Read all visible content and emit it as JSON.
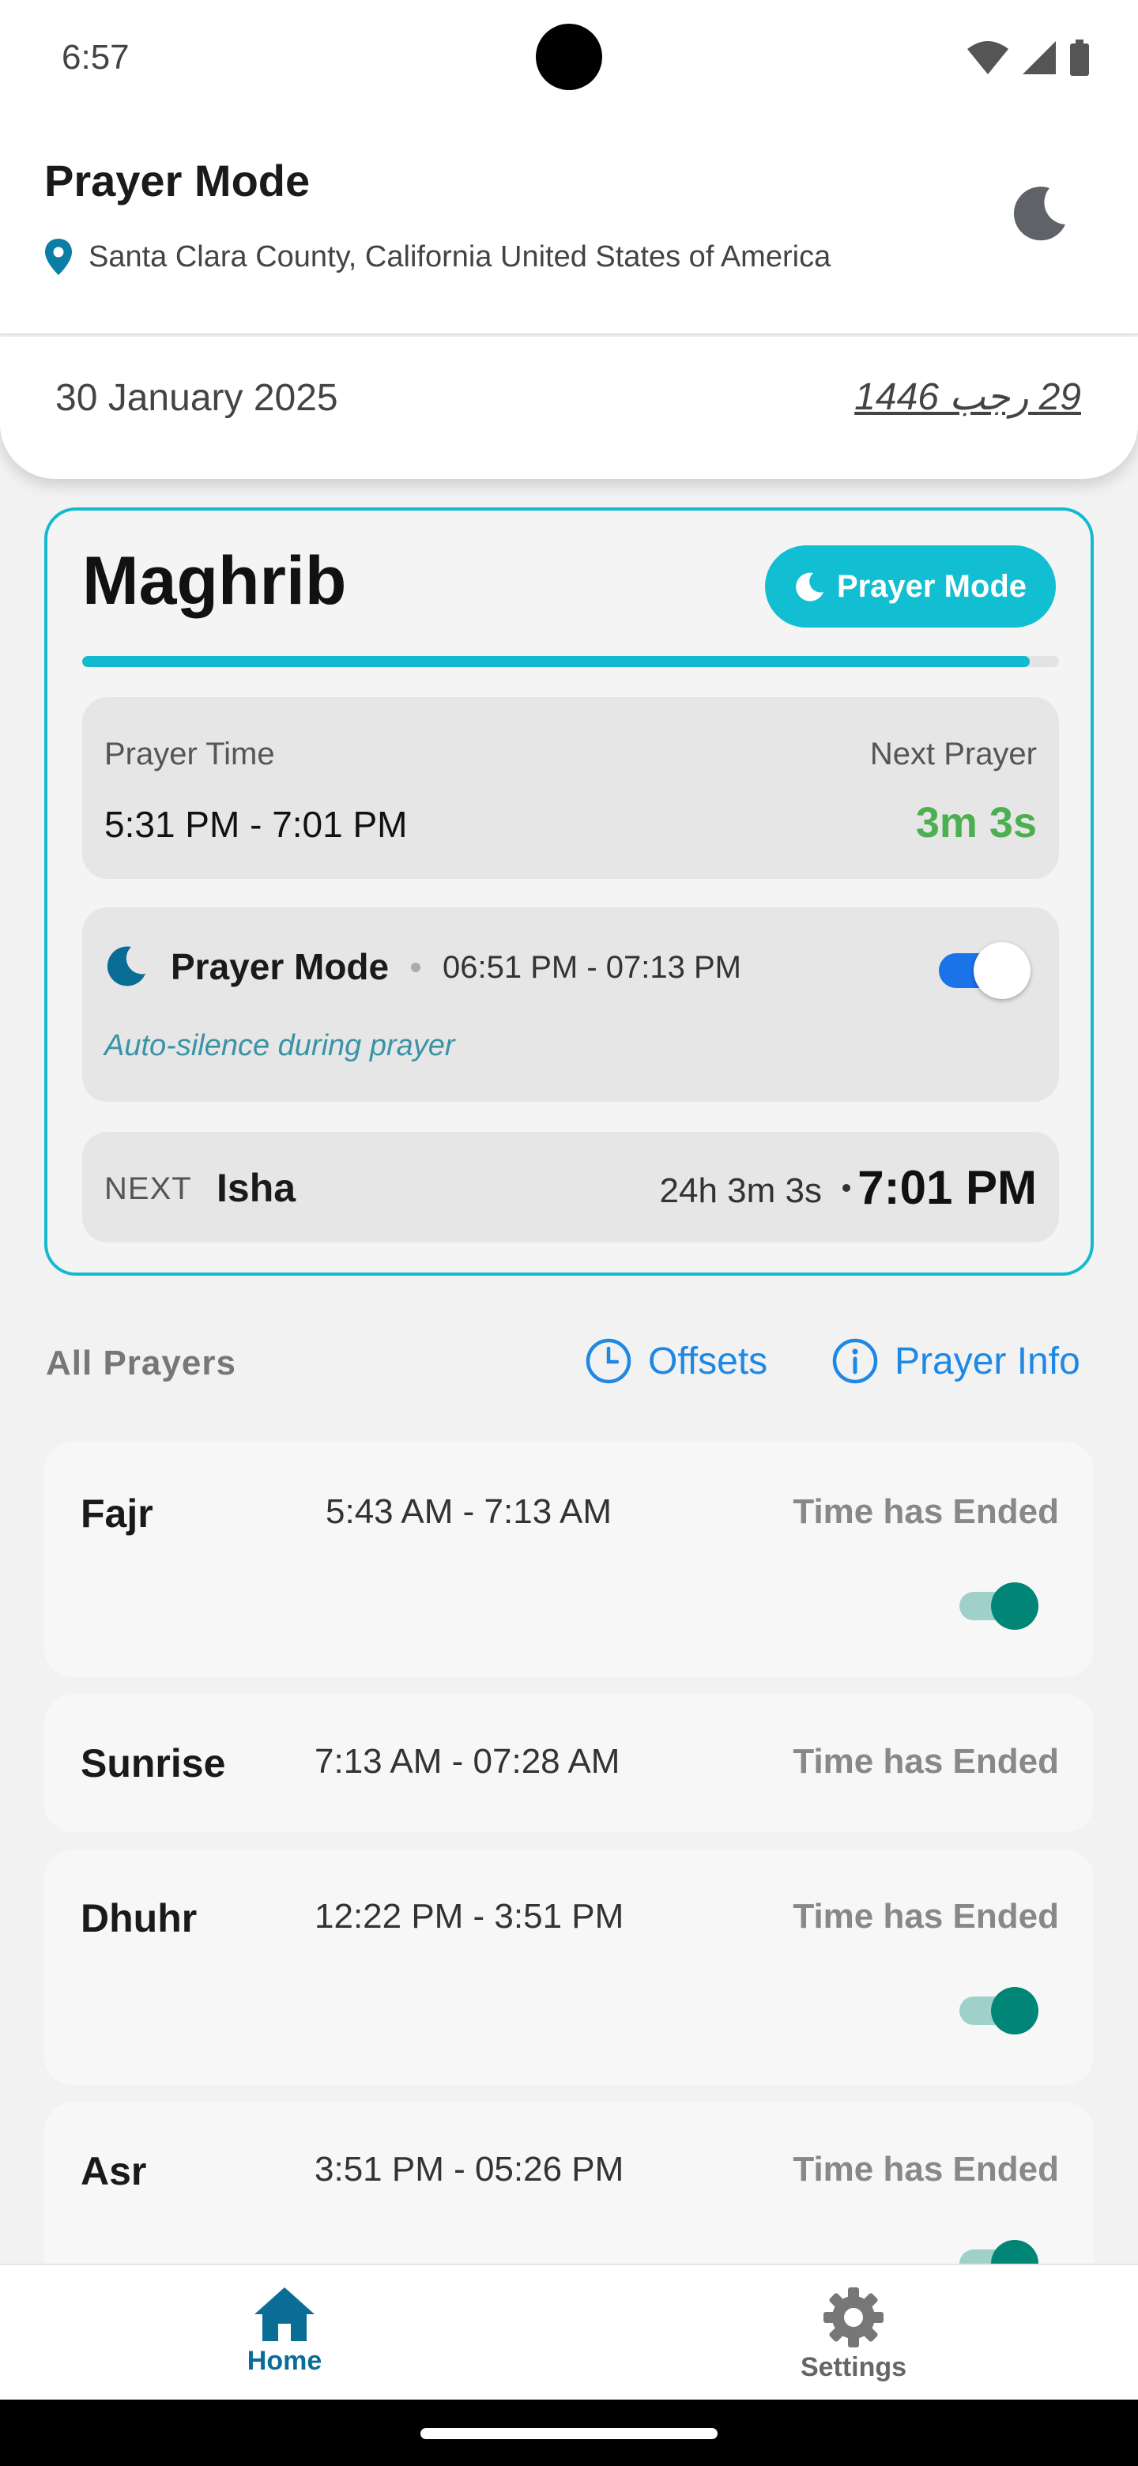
{
  "status_bar": {
    "time": "6:57"
  },
  "header": {
    "title": "Prayer Mode",
    "location": "Santa Clara County, California United States of America"
  },
  "dates": {
    "gregorian": "30 January 2025",
    "hijri": "29 رجب 1446"
  },
  "current_prayer": {
    "name": "Maghrib",
    "mode_button_label": "Prayer Mode",
    "progress": 0.97,
    "prayer_time_label": "Prayer Time",
    "prayer_time_range": "5:31 PM - 7:01 PM",
    "next_prayer_label": "Next Prayer",
    "next_prayer_countdown": "3m 3s",
    "prayer_mode": {
      "title": "Prayer Mode",
      "range": "06:51 PM - 07:13 PM",
      "subtitle": "Auto-silence during prayer",
      "enabled": true
    },
    "next": {
      "label": "NEXT",
      "name": "Isha",
      "countdown": "24h 3m 3s",
      "time": "7:01 PM"
    }
  },
  "all_prayers": {
    "title": "All Prayers",
    "offsets_label": "Offsets",
    "info_label": "Prayer Info",
    "items": [
      {
        "name": "Fajr",
        "range": "5:43 AM - 7:13 AM",
        "status": "Time has Ended",
        "toggle": true
      },
      {
        "name": "Sunrise",
        "range": "7:13 AM - 07:28 AM",
        "status": "Time has Ended",
        "toggle": false
      },
      {
        "name": "Dhuhr",
        "range": "12:22 PM - 3:51 PM",
        "status": "Time has Ended",
        "toggle": true
      },
      {
        "name": "Asr",
        "range": "3:51 PM - 05:26 PM",
        "status": "Time has Ended",
        "toggle": true
      }
    ]
  },
  "bottom_nav": {
    "home_label": "Home",
    "settings_label": "Settings"
  },
  "colors": {
    "accent_cyan": "#13b9cf",
    "countdown_green": "#4caf50",
    "link_blue": "#1e88e5",
    "toggle_teal": "#008577",
    "nav_active": "#0a6d96"
  }
}
